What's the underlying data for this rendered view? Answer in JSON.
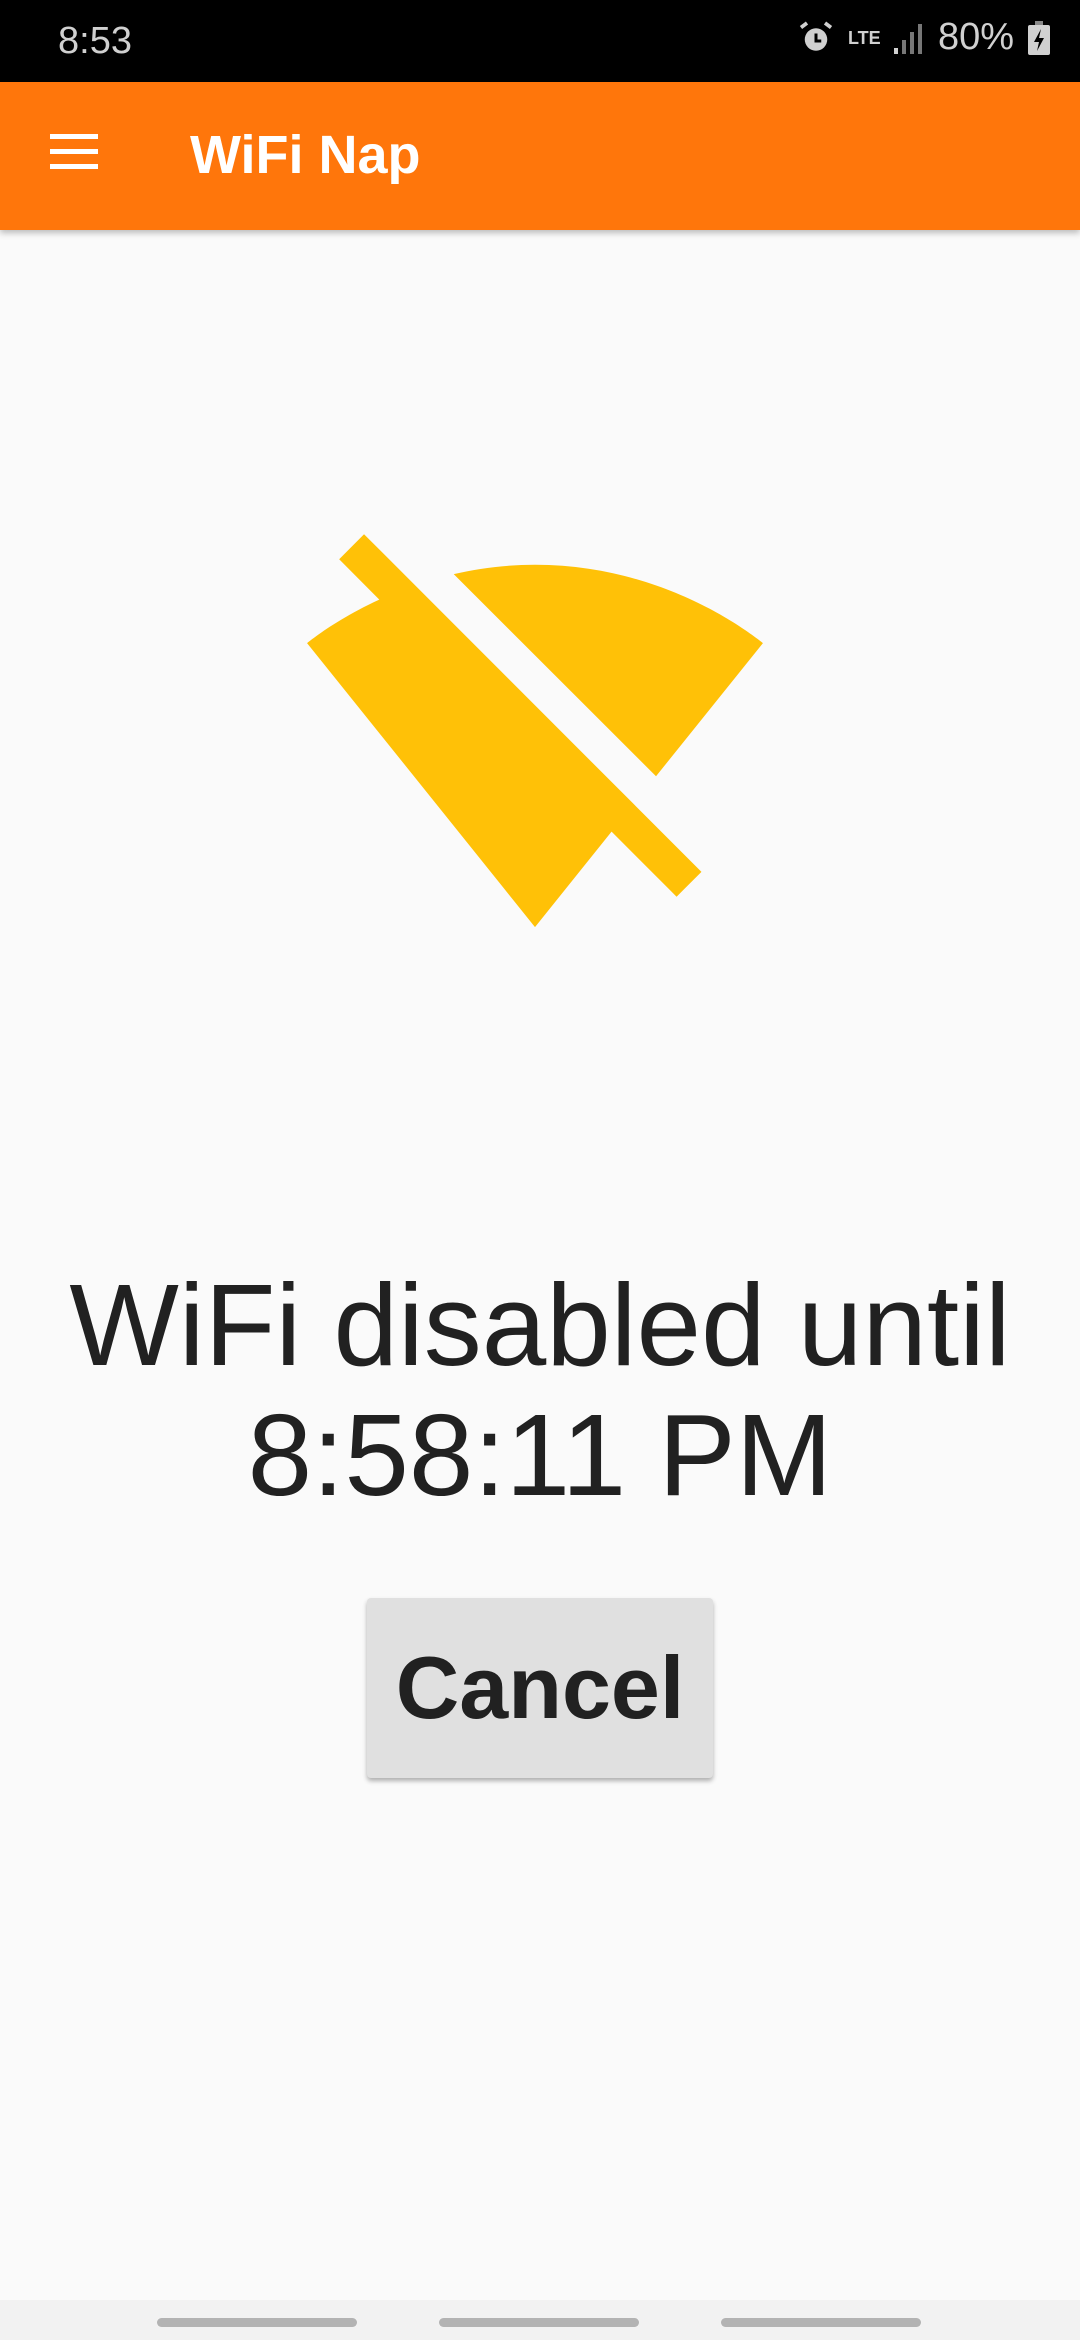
{
  "status_bar": {
    "time": "8:53",
    "network": "LTE",
    "battery": "80%"
  },
  "app_bar": {
    "title": "WiFi Nap"
  },
  "main": {
    "message_line1": "WiFi disabled until",
    "message_line2": "8:58:11 PM",
    "cancel_label": "Cancel",
    "icon_color": "#ffc107"
  },
  "colors": {
    "accent": "#ff760b"
  }
}
